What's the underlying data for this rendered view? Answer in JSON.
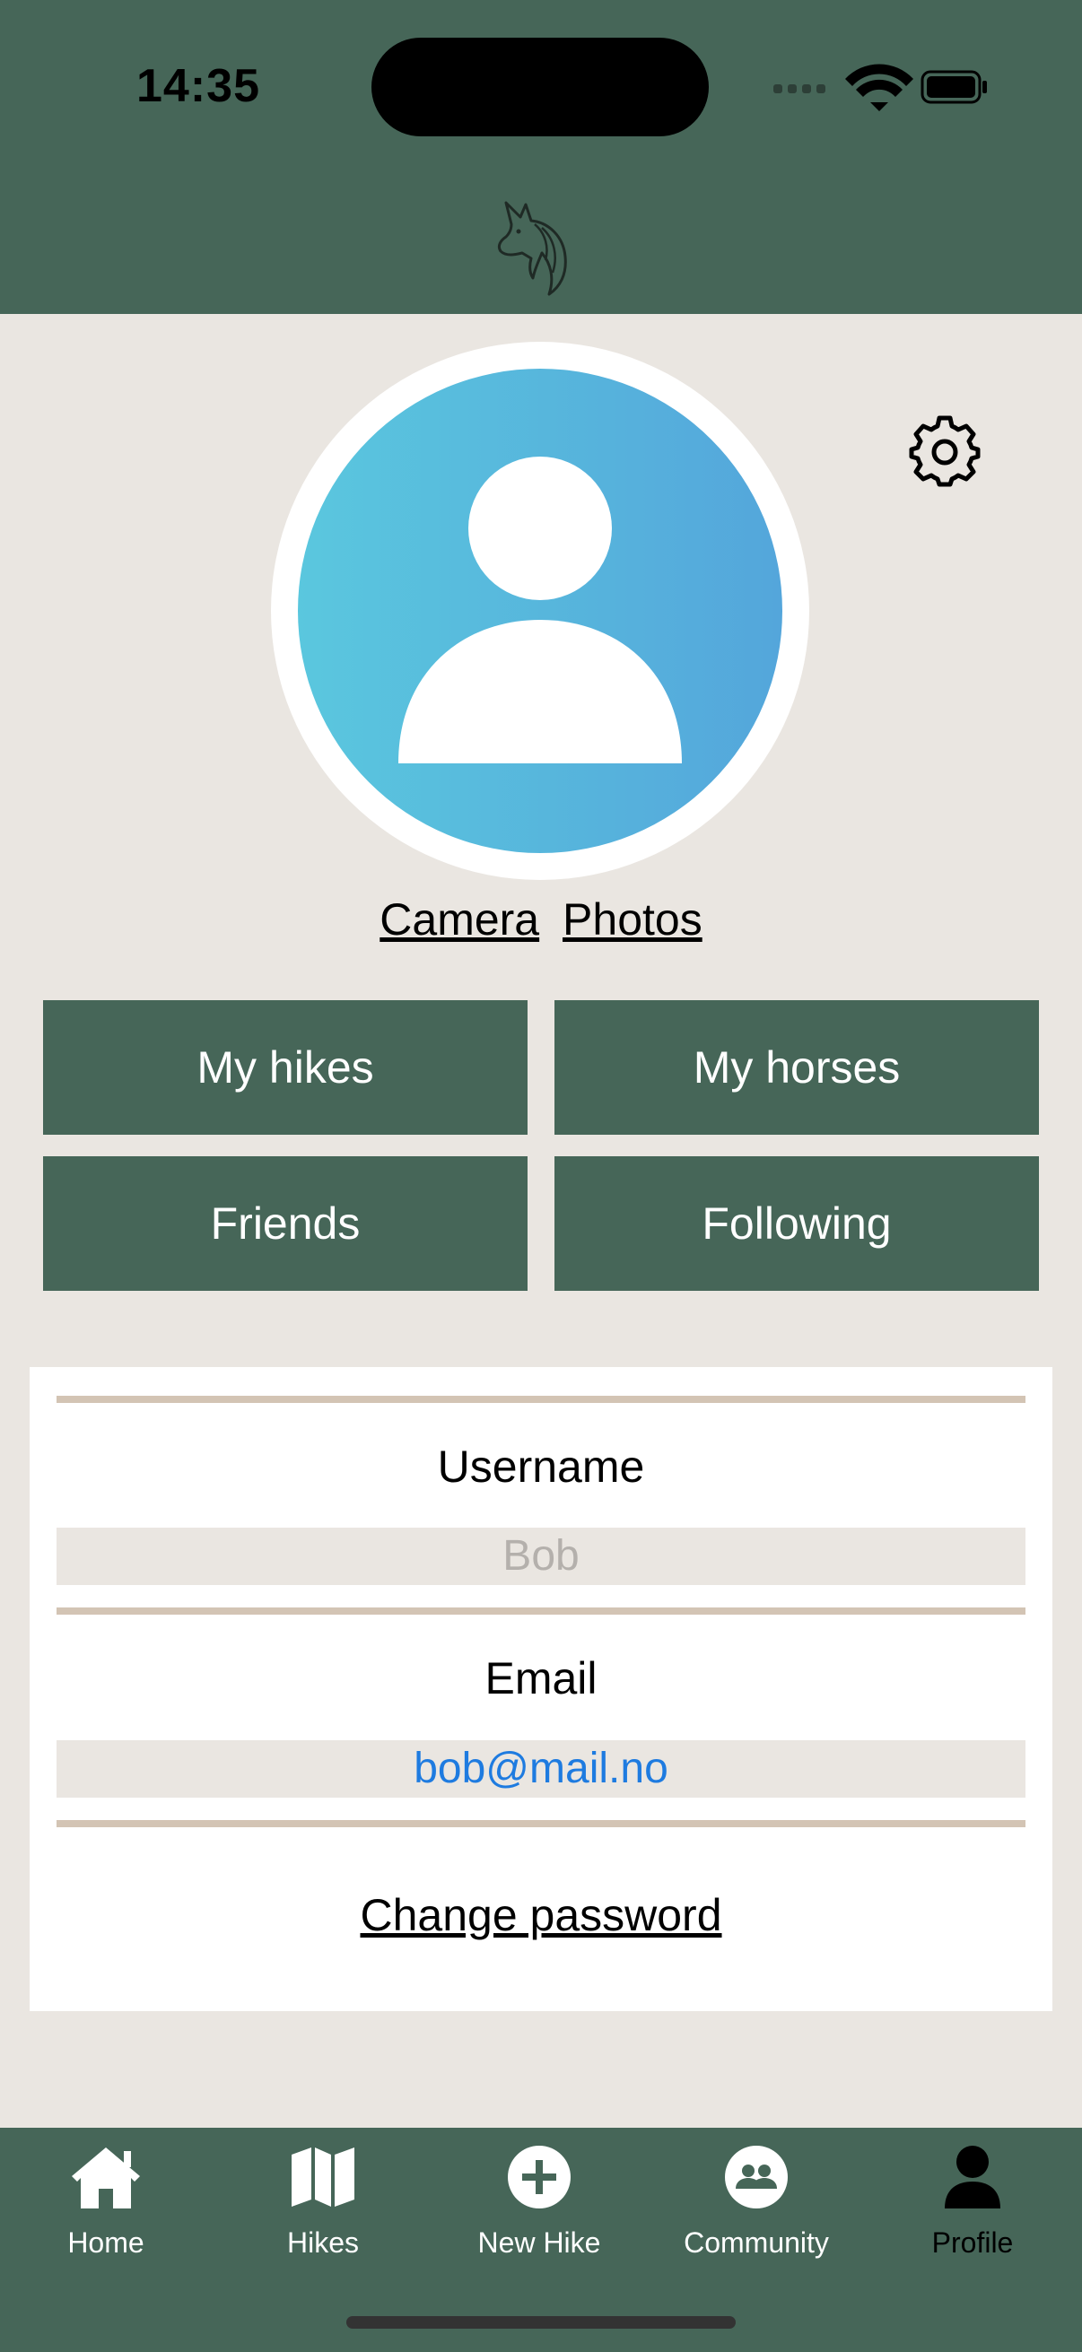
{
  "status": {
    "time": "14:35"
  },
  "profile": {
    "photo_links": {
      "camera": "Camera",
      "photos": "Photos"
    },
    "tiles": {
      "my_hikes": "My hikes",
      "my_horses": "My horses",
      "friends": "Friends",
      "following": "Following"
    }
  },
  "account": {
    "username_label": "Username",
    "username_placeholder": "Bob",
    "email_label": "Email",
    "email_value": "bob@mail.no",
    "change_password": "Change password"
  },
  "tabs": [
    {
      "label": "Home",
      "icon": "home-icon"
    },
    {
      "label": "Hikes",
      "icon": "map-icon"
    },
    {
      "label": "New Hike",
      "icon": "plus-circle-icon"
    },
    {
      "label": "Community",
      "icon": "community-icon"
    },
    {
      "label": "Profile",
      "icon": "person-icon",
      "active": true
    }
  ],
  "colors": {
    "header": "#466658",
    "background": "#EAE6E1",
    "divider": "#D3C4B4",
    "link": "#1E7BE0",
    "placeholder": "#B4B0AC",
    "active_tab": "#000000"
  }
}
